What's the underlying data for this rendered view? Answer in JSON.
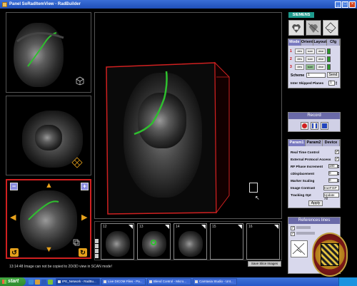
{
  "window": {
    "title": "Panel SoRadItemView - RadBuilder"
  },
  "viewers": {
    "main_caption": "",
    "status_message": "13:14:48    Image can not be copied to 2D/3D view in SCAN mode!",
    "save_button": "Save Slice Images"
  },
  "thumbnails": [
    {
      "num": "12"
    },
    {
      "num": "13"
    },
    {
      "num": "14"
    },
    {
      "num": "15"
    },
    {
      "num": "16"
    }
  ],
  "panel": {
    "brand": "SIEMENS",
    "mode_tabs": [
      "Mode",
      "Orient",
      "Layout",
      "Cfg"
    ],
    "mode_rows": [
      {
        "num": "1",
        "buttons": [
          "view",
          "scan",
          "clear"
        ]
      },
      {
        "num": "2",
        "buttons": [
          "view",
          "scan",
          "clear"
        ]
      },
      {
        "num": "3",
        "buttons": [
          "view",
          "scan",
          "clear"
        ]
      }
    ],
    "scheme_label": "Scheme",
    "scheme_value": "1",
    "send_label": "Send",
    "inter_label": "Inter Skipped Planes",
    "inter_value": "1",
    "record_label": "Record",
    "param_tabs": [
      "Param1",
      "Param2",
      "Device"
    ],
    "params": [
      {
        "label": "Real Time Control",
        "kind": "check",
        "value": "✓"
      },
      {
        "label": "External Protocol Access",
        "kind": "check",
        "value": "✓"
      },
      {
        "label": "RF Phase Increment",
        "kind": "num",
        "value": "180"
      },
      {
        "label": "cDisplacement",
        "kind": "num",
        "value": "0"
      },
      {
        "label": "Marker Scaling",
        "kind": "num",
        "value": "0"
      },
      {
        "label": "Image Contrast",
        "kind": "select",
        "value": "trueFISP"
      },
      {
        "label": "Tracking Opt",
        "kind": "select",
        "value": "Update All"
      }
    ],
    "apply_label": "Apply",
    "references_label": "References lines"
  },
  "taskbar": {
    "start_label": "start",
    "tasks": [
      "IPE_Network - RadBu...",
      "Live DICOM Files - Pa...",
      "Blend Control - Micro...",
      "Camtasia Studio - Unt..."
    ],
    "clock": ""
  },
  "colors": {
    "accent_red": "#d02020",
    "accent_orange": "#e6a11b",
    "siemens_teal": "#1d9a8c",
    "panel_header": "#6a6aa8",
    "taskbar_blue": "#2457c8"
  }
}
